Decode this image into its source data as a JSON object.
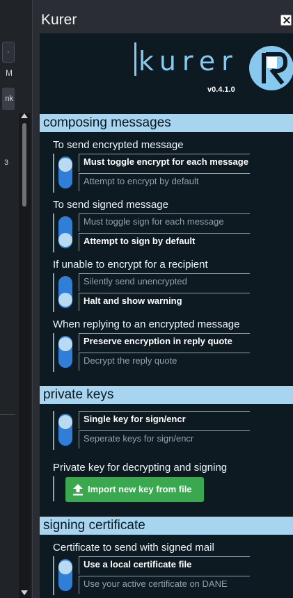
{
  "background_app": {
    "btn_label": "·",
    "label_m": "M",
    "label_nk": "nk",
    "label_3": "3"
  },
  "panel": {
    "title": "Kurer",
    "close_label": "close"
  },
  "logo": {
    "text": "kurer",
    "version": "v0.4.1.0"
  },
  "sections": {
    "composing": {
      "title": "composing messages",
      "groups": [
        {
          "label": "To send encrypted message",
          "options": [
            "Must toggle encrypt for each message",
            "Attempt to encrypt by default"
          ],
          "active": 0
        },
        {
          "label": "To send signed message",
          "options": [
            "Must toggle sign for each message",
            "Attempt to sign by default"
          ],
          "active": 1
        },
        {
          "label": "If unable to encrypt for a recipient",
          "options": [
            "Silently send unencrypted",
            "Halt and show warning"
          ],
          "active": 1
        },
        {
          "label": "When replying to an encrypted message",
          "options": [
            "Preserve encryption in reply quote",
            "Decrypt the reply quote"
          ],
          "active": 0
        }
      ]
    },
    "private_keys": {
      "title": "private keys",
      "groups": [
        {
          "label": "",
          "options": [
            "Single key for sign/encr",
            "Seperate keys for sign/encr"
          ],
          "active": 0
        }
      ],
      "decrypt_label": "Private key for decrypting and signing",
      "import_button": "Import new key from file"
    },
    "signing_certificate": {
      "title": "signing certificate",
      "groups": [
        {
          "label": "Certificate to send with signed mail",
          "options": [
            "Use a local certificate file",
            "Use your active certificate on DANE"
          ],
          "active": 0
        }
      ]
    }
  },
  "colors": {
    "accent": "#87c9ee",
    "section_bg": "#a7d4ee",
    "toggle_track": "#2f7fd8",
    "toggle_knob": "#b9daf1",
    "import_button": "#3aa84f",
    "content_bg": "#0e1a22"
  }
}
